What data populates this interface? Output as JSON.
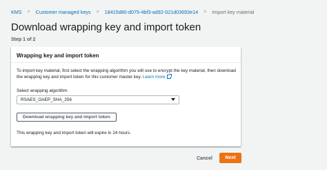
{
  "breadcrumb": {
    "items": [
      "KMS",
      "Customer managed keys",
      "18415d80-d075-4bf3-ad92-021d03693e14",
      "Import key material"
    ],
    "separator": ">"
  },
  "page": {
    "title": "Download wrapping key and import token",
    "step": "Step 1 of 2"
  },
  "panel": {
    "title": "Wrapping key and import token",
    "description": "To import key material, first select the wrapping algorithm you will use to encrypt the key material, then download the wrapping key and import token for this customer master key.",
    "learn_more": "Learn more",
    "select_label": "Select wrapping algorithm",
    "select_value": "RSAES_OAEP_SHA_256",
    "download_button": "Download wrapping key and import token",
    "expiry_note": "This wrapping key and import token will expire in 24 hours."
  },
  "footer": {
    "cancel": "Cancel",
    "next": "Next"
  },
  "colors": {
    "link": "#0073bb",
    "primary": "#ec7211",
    "background": "#f2f3f3"
  },
  "icons": [
    "external-link-icon",
    "caret-down-icon"
  ]
}
